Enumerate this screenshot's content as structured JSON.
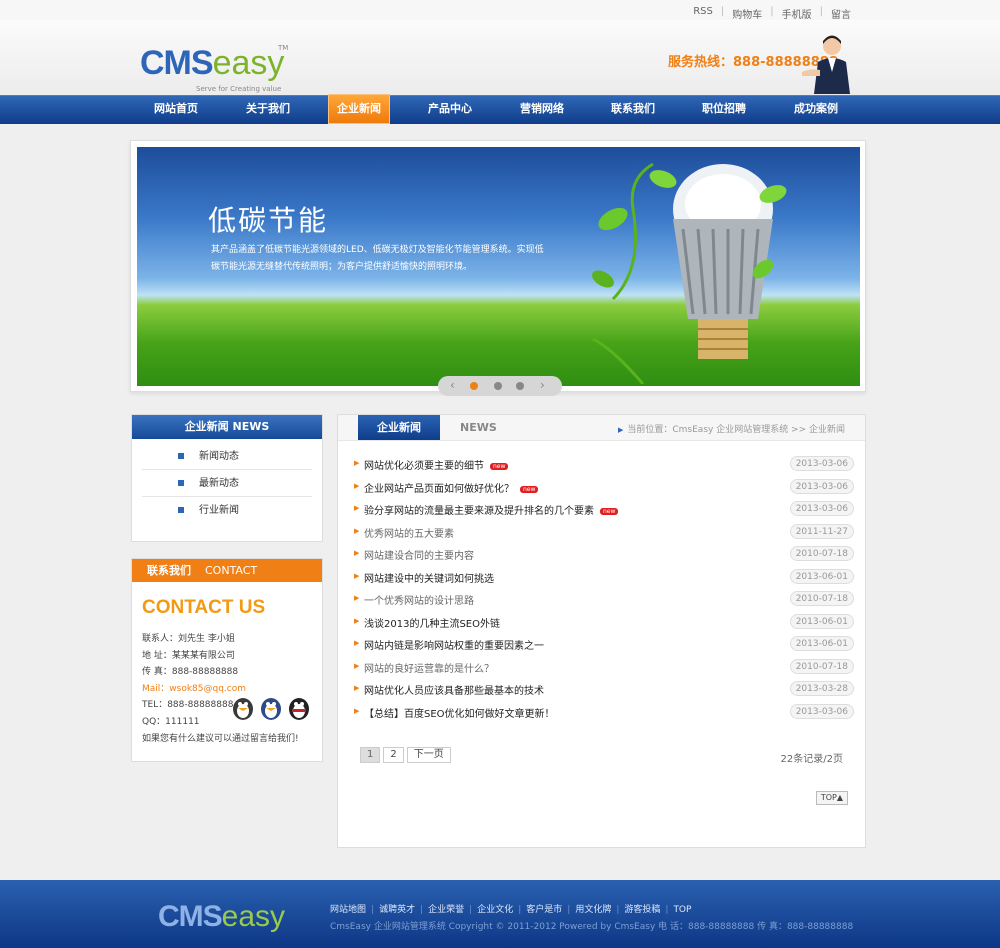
{
  "toplinks": [
    "RSS",
    "购物车",
    "手机版",
    "留言"
  ],
  "logo": {
    "cms": "CMS",
    "easy": "easy",
    "tm": "TM",
    "tagline": "Serve for Creating value"
  },
  "hotline": "服务热线：888-88888888",
  "nav": [
    "网站首页",
    "关于我们",
    "企业新闻",
    "产品中心",
    "营销网络",
    "联系我们",
    "职位招聘",
    "成功案例"
  ],
  "nav_active": "企业新闻",
  "banner": {
    "title": "低碳节能",
    "text": "其产品涵盖了低碳节能光源领域的LED、低碳无极灯及智能化节能管理系统。实现低碳节能光源无缝替代传统照明；为客户提供舒适愉快的照明环境。",
    "prev": "‹",
    "next": "›"
  },
  "side_news": {
    "title": "企业新闻 NEWS",
    "items": [
      "新闻动态",
      "最新动态",
      "行业新闻"
    ]
  },
  "side_contact": {
    "title": "联系我们",
    "title_en": "CONTACT",
    "big": "CONTACT US",
    "lines": {
      "contact": "联系人：刘先生 李小姐",
      "address": "地 址：某某某有限公司",
      "fax": "传 真：888-88888888",
      "mail": "Mail：wsok85@qq.com",
      "tel": "TEL：888-88888888",
      "qq": "QQ：111111",
      "note": "如果您有什么建议可以通过留言给我们!"
    },
    "qq_colors": [
      "#3a3a3a",
      "#2d4a8a",
      "#c0262a"
    ]
  },
  "main": {
    "tab": "企业新闻",
    "tab_en": "NEWS",
    "breadcrumb": "当前位置：CmsEasy 企业网站管理系统 >> 企业新闻",
    "articles": [
      {
        "title": "网站优化必须要主要的细节",
        "date": "2013-03-06",
        "new": "new"
      },
      {
        "title": "企业网站产品页面如何做好优化？",
        "date": "2013-03-06",
        "new": "new"
      },
      {
        "title": "验分享网站的流量最主要来源及提升排名的几个要素",
        "date": "2013-03-06",
        "new": "new"
      },
      {
        "title": "优秀网站的五大要素",
        "date": "2011-11-27",
        "new": ""
      },
      {
        "title": "网站建设合同的主要内容",
        "date": "2010-07-18",
        "new": ""
      },
      {
        "title": "网站建设中的关键词如何挑选",
        "date": "2013-06-01",
        "new": ""
      },
      {
        "title": "一个优秀网站的设计思路",
        "date": "2010-07-18",
        "new": ""
      },
      {
        "title": "浅谈2013的几种主流SEO外链",
        "date": "2013-06-01",
        "new": ""
      },
      {
        "title": "网站内链是影响网站权重的重要因素之一",
        "date": "2013-06-01",
        "new": ""
      },
      {
        "title": "网站的良好运营靠的是什么？",
        "date": "2010-07-18",
        "new": ""
      },
      {
        "title": "网站优化人员应该具备那些最基本的技术",
        "date": "2013-03-28",
        "new": ""
      },
      {
        "title": "【总结】百度SEO优化如何做好文章更新！",
        "date": "2013-03-06",
        "new": ""
      }
    ],
    "pager": [
      "1",
      "2",
      "下一页"
    ],
    "records": "22条记录/2页",
    "top": "TOP▲"
  },
  "footer": {
    "logo_cms": "CMS",
    "logo_easy": "easy",
    "links": [
      "网站地图",
      "诚聘英才",
      "企业荣誉",
      "企业文化",
      "客户是市",
      "用文化牌",
      "游客投稿",
      "TOP"
    ],
    "copy": "CmsEasy 企业网站管理系统  Copyright © 2011-2012  Powered by  CmsEasy    电 话：888-88888888   传 真：888-88888888"
  },
  "colors": {
    "brand_blue": "#2d66b8",
    "accent_orange": "#f07f15",
    "green": "#7cb32a"
  }
}
